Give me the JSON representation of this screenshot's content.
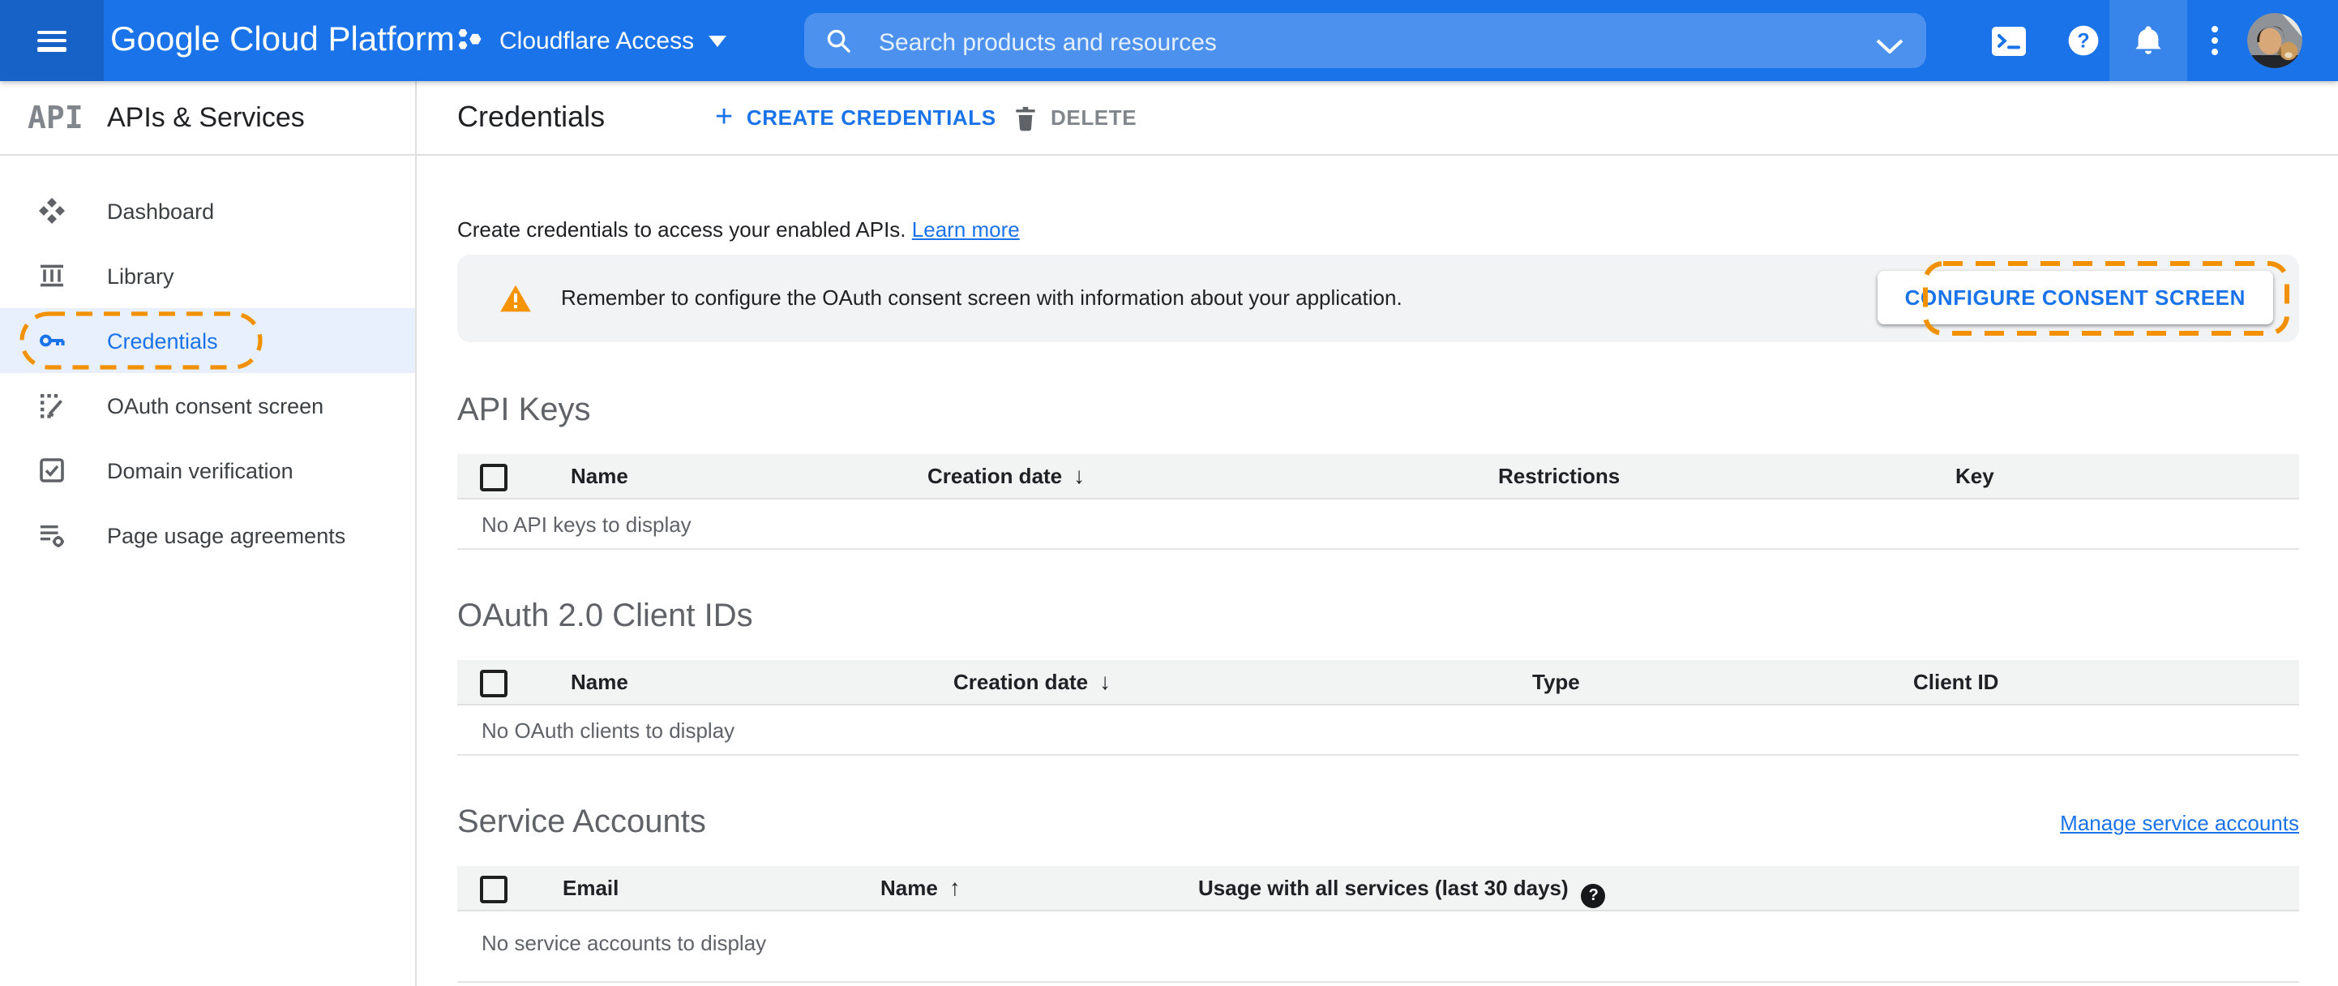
{
  "app_bar": {
    "product_name": "Google Cloud Platform",
    "project_selector": {
      "label": "Cloudflare Access"
    },
    "search": {
      "placeholder": "Search products and resources"
    }
  },
  "sidebar": {
    "logo_glyph": "API",
    "title": "APIs & Services",
    "items": [
      {
        "label": "Dashboard",
        "icon": "dashboard-icon",
        "active": false
      },
      {
        "label": "Library",
        "icon": "library-icon",
        "active": false
      },
      {
        "label": "Credentials",
        "icon": "key-icon",
        "active": true,
        "highlighted": true
      },
      {
        "label": "OAuth consent screen",
        "icon": "oauth-consent-icon",
        "active": false
      },
      {
        "label": "Domain verification",
        "icon": "domain-verification-icon",
        "active": false
      },
      {
        "label": "Page usage agreements",
        "icon": "page-usage-icon",
        "active": false
      }
    ]
  },
  "page": {
    "title": "Credentials",
    "create_button": "CREATE CREDENTIALS",
    "delete_button": "DELETE",
    "description": "Create credentials to access your enabled APIs.",
    "learn_more_link": "Learn more",
    "banner": {
      "message": "Remember to configure the OAuth consent screen with information about your application.",
      "button": "CONFIGURE CONSENT SCREEN"
    }
  },
  "sections": {
    "api_keys": {
      "title": "API Keys",
      "columns": [
        "Name",
        "Creation date",
        "Restrictions",
        "Key"
      ],
      "sort_column": "Creation date",
      "sort_direction": "descending",
      "empty_message": "No API keys to display"
    },
    "oauth_clients": {
      "title": "OAuth 2.0 Client IDs",
      "columns": [
        "Name",
        "Creation date",
        "Type",
        "Client ID"
      ],
      "sort_column": "Creation date",
      "sort_direction": "descending",
      "empty_message": "No OAuth clients to display"
    },
    "service_accounts": {
      "title": "Service Accounts",
      "manage_link": "Manage service accounts",
      "columns": [
        "Email",
        "Name",
        "Usage with all services (last 30 days)"
      ],
      "sort_column": "Name",
      "sort_direction": "ascending",
      "empty_message": "No service accounts to display"
    }
  },
  "icons": {
    "sort_desc": "↓",
    "sort_asc": "↑",
    "help_badge": "?",
    "plus": "+"
  },
  "colors": {
    "app_bar_blue": "#1a73e8",
    "accent_blue": "#1a73e8",
    "annotation_orange": "#f29100",
    "warning_orange": "#f9ab00",
    "active_item_bg": "#e8f0fe"
  }
}
